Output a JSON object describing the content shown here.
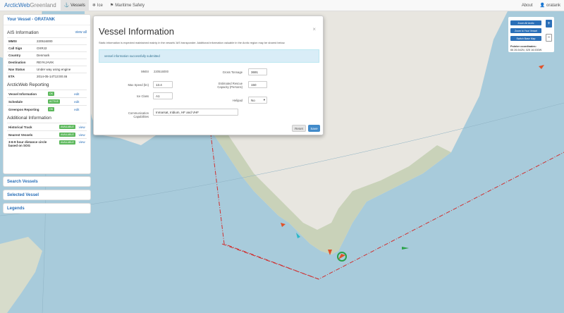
{
  "colors": {
    "accent": "#2a6fb8",
    "active_badge": "#5cb85c",
    "danger_line": "#d03030",
    "ship_red": "#e0522a",
    "ship_green": "#2aa24a"
  },
  "navbar": {
    "brand_main": "ArcticWeb",
    "brand_sub": "Greenland",
    "items": [
      {
        "label": "Vessels",
        "icon": "anchor-icon"
      },
      {
        "label": "Ice",
        "icon": "snowflake-icon"
      },
      {
        "label": "Maritime Safety",
        "icon": "flag-icon"
      }
    ],
    "right": [
      {
        "label": "About"
      },
      {
        "label": "oratank",
        "icon": "user-icon"
      }
    ]
  },
  "your_vessel": {
    "title": "Your Vessel - ORATANK",
    "ais_title": "AIS Information",
    "view_all": "view all",
    "ais_rows": [
      {
        "k": "MMSI",
        "v": "220516000"
      },
      {
        "k": "Call Sign",
        "v": "OXRJ2"
      },
      {
        "k": "Country",
        "v": "Denmark"
      },
      {
        "k": "Destination",
        "v": "REYKJAVIK"
      },
      {
        "k": "Nav Status",
        "v": "Under way using engine"
      },
      {
        "k": "ETA",
        "v": "2014-05-14T13:00:46"
      }
    ],
    "reporting_title": "ArcticWeb Reporting",
    "reporting_rows": [
      {
        "k": "Vessel Information",
        "badge": "OK",
        "link": "edit"
      },
      {
        "k": "Schedule",
        "badge": "ACTIVE",
        "link": "edit"
      },
      {
        "k": "Greenpos Reporting",
        "badge": "OK",
        "link": "edit"
      }
    ],
    "additional_title": "Additional Information",
    "additional_rows": [
      {
        "k": "Historical Track",
        "badge": "AVAILABLE",
        "link": "view"
      },
      {
        "k": "Nearest Vessels",
        "badge": "AVAILABLE",
        "link": "view"
      },
      {
        "k": "3-6-9 hour distance circle based on SOG",
        "badge": "AVAILABLE",
        "link": "view"
      }
    ]
  },
  "panels": {
    "search": "Search Vessels",
    "selected": "Selected Vessel",
    "legends": "Legends"
  },
  "modal": {
    "title": "Vessel Information",
    "close": "×",
    "description": "Static information is expected maintained mainly in the vessels' AIS transponder. Additional information valuable in the Arctic region may be shared below.",
    "alert": "vessel information successfully submitted",
    "mmsi_label": "MMSI",
    "mmsi_value": "220516000",
    "max_speed_label": "Max Speed (kn)",
    "max_speed_value": "13.4",
    "ice_class_label": "Ice Class",
    "ice_class_value": "A1",
    "gross_tonnage_label": "Gross Tonnage",
    "gross_tonnage_value": "3691",
    "rescue_label_1": "Estimated Rescue",
    "rescue_label_2": "Capacity (Persons)",
    "rescue_value": "150",
    "helipad_label": "Helipad",
    "helipad_value": "No",
    "comm_label_1": "Communication",
    "comm_label_2": "Capabilities",
    "comm_value": "Inmarsat, Iridium, HF and VHF",
    "reset": "Reset",
    "save": "Save"
  },
  "map_controls": {
    "zoom_all": "Zoom All Arctic",
    "zoom_vessel": "Zoom to Your Vessel",
    "switch_base": "Switch Base Map",
    "zoom_in": "+",
    "zoom_out": "−",
    "pointer_label": "Pointer coordinates:",
    "pointer_value": "66 26.542N, 025 16.530W"
  }
}
